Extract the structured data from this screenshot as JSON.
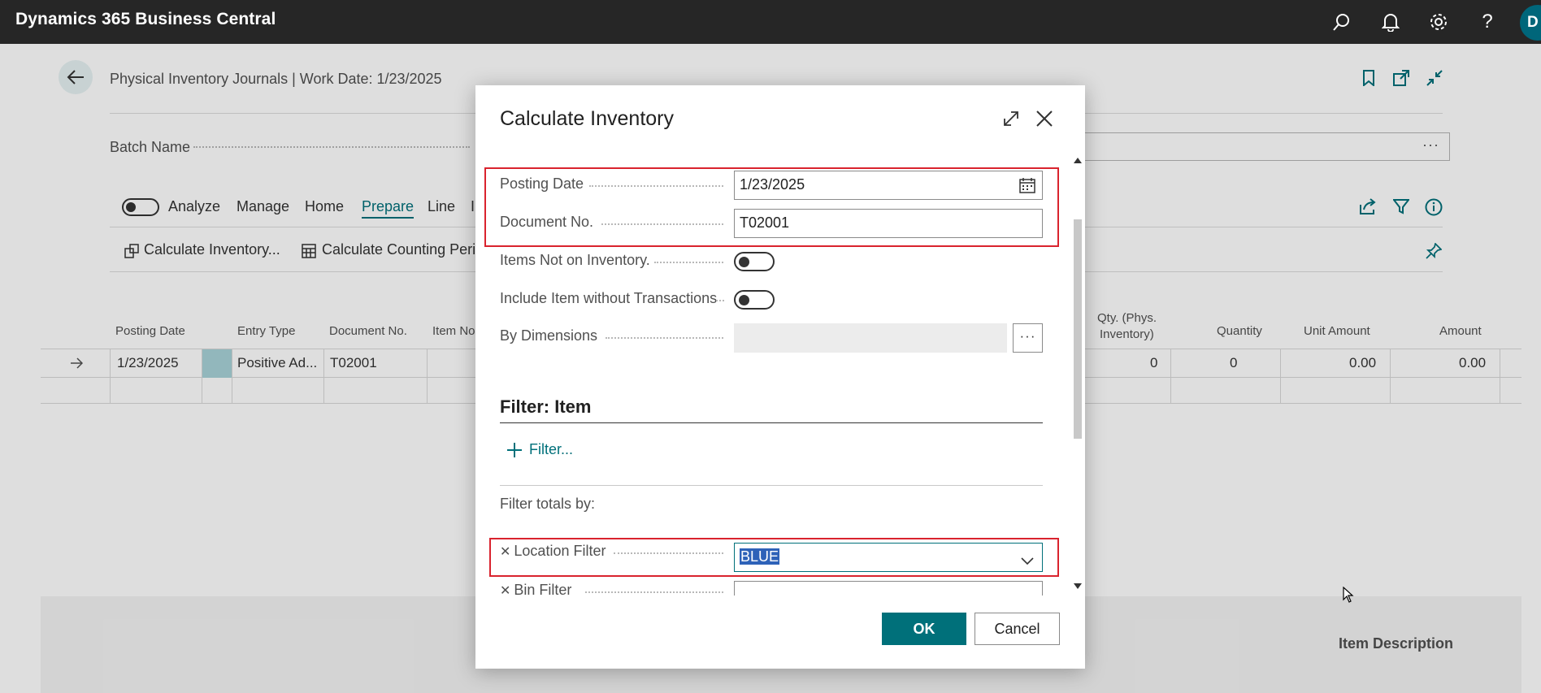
{
  "app": {
    "title": "Dynamics 365 Business Central",
    "avatar_initial": "D"
  },
  "page": {
    "title": "Physical Inventory Journals | Work Date: 1/23/2025",
    "batch_label": "Batch Name",
    "tabs": [
      "Analyze",
      "Manage",
      "Home",
      "Prepare",
      "Line",
      "I"
    ],
    "actions": [
      "Calculate Inventory...",
      "Calculate Counting Perio"
    ],
    "grid": {
      "columns": [
        "Posting Date",
        "Entry Type",
        "Document No.",
        "Item No",
        "Qty. (Phys.",
        "Inventory)",
        "Quantity",
        "Unit Amount",
        "Amount"
      ],
      "row": {
        "posting_date": "1/23/2025",
        "entry_type": "Positive Ad...",
        "document_no": "T02001",
        "qty_phys": "0",
        "quantity": "0",
        "unit_amount": "0.00",
        "amount": "0.00"
      }
    },
    "factbox_title": "Item Description"
  },
  "dialog": {
    "title": "Calculate Inventory",
    "fields": {
      "posting_date": {
        "label": "Posting Date",
        "value": "1/23/2025"
      },
      "document_no": {
        "label": "Document No.",
        "value": "T02001"
      },
      "items_not_on_inventory": {
        "label": "Items Not on Inventory.",
        "value": false
      },
      "include_item": {
        "label": "Include Item without Transactions",
        "value": false
      },
      "by_dimensions": {
        "label": "By Dimensions",
        "value": ""
      }
    },
    "filter_section": "Filter: Item",
    "filter_link": "Filter...",
    "filter_totals": "Filter totals by:",
    "location_filter": {
      "label": "Location Filter",
      "value": "BLUE"
    },
    "bin_filter": {
      "label": "Bin Filter",
      "value": ""
    },
    "ok": "OK",
    "cancel": "Cancel"
  },
  "colors": {
    "accent": "#00707a",
    "highlight": "#d9232e",
    "topbar": "#262626"
  }
}
